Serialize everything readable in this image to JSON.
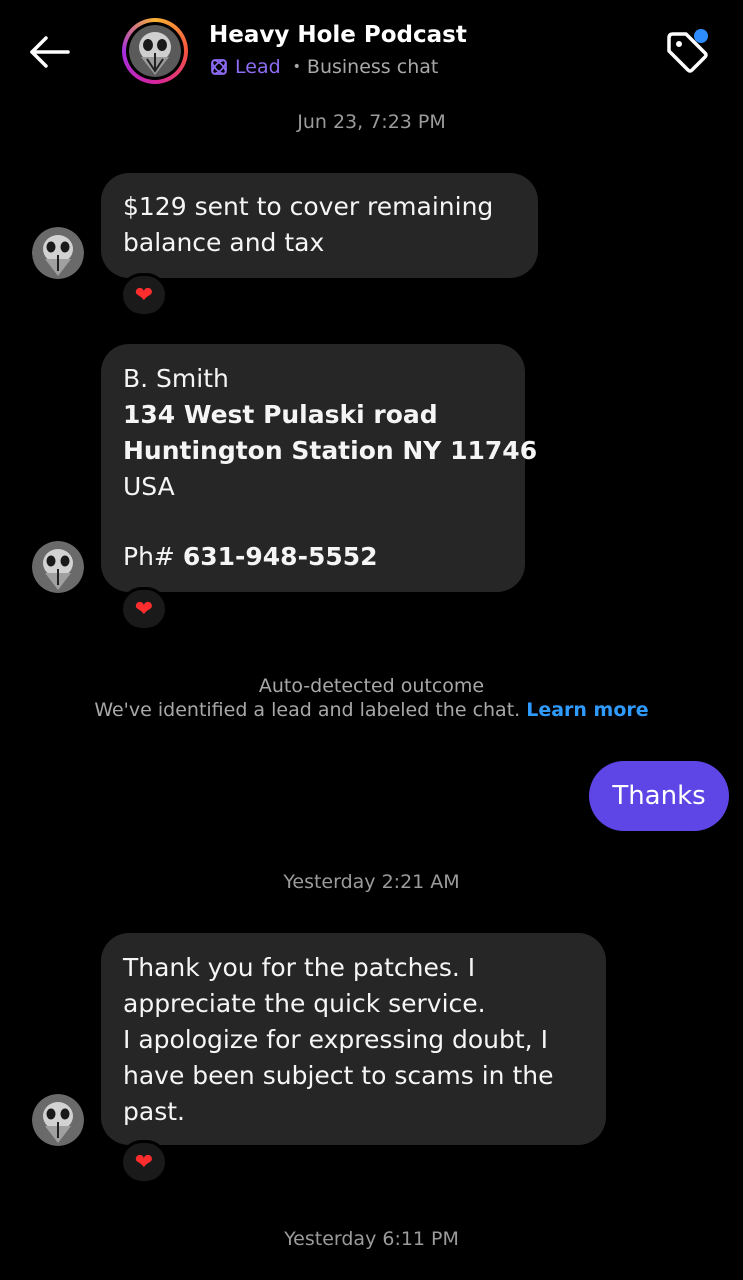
{
  "header": {
    "title": "Heavy Hole Podcast",
    "lead_label": "Lead",
    "separator": "•",
    "subtitle": "Business chat",
    "back_icon": "arrow-left-icon",
    "tag_icon": "tag-icon"
  },
  "thread": {
    "stamp_1": "Jun 23, 7:23 PM",
    "msg_1": {
      "lines": [
        "$129 sent to cover remaining",
        "balance and tax"
      ],
      "reaction": "❤"
    },
    "msg_2": {
      "name": "B. Smith",
      "street": "134 West Pulaski road",
      "city": "Huntington Station NY 11746",
      "country": "USA",
      "phone_prefix": "Ph# ",
      "phone": "631-948-5552",
      "reaction": "❤"
    },
    "notice": {
      "title": "Auto-detected outcome",
      "body": "We've identified a lead and labeled the chat. ",
      "link": "Learn more"
    },
    "msg_out_1": "Thanks",
    "stamp_2": "Yesterday 2:21 AM",
    "msg_3": {
      "lines": [
        "Thank you for the patches. I",
        "appreciate the quick service.",
        "I apologize for expressing doubt, I",
        "have been subject to scams in the",
        "past."
      ],
      "reaction": "❤"
    },
    "stamp_3": "Yesterday 6:11 PM"
  },
  "colors": {
    "background": "#000000",
    "incoming_bubble": "#262626",
    "outgoing_bubble": "#5e45e6",
    "lead_accent": "#8e6cf5",
    "link": "#2f9bff",
    "reaction_heart": "#ff2d2d"
  }
}
